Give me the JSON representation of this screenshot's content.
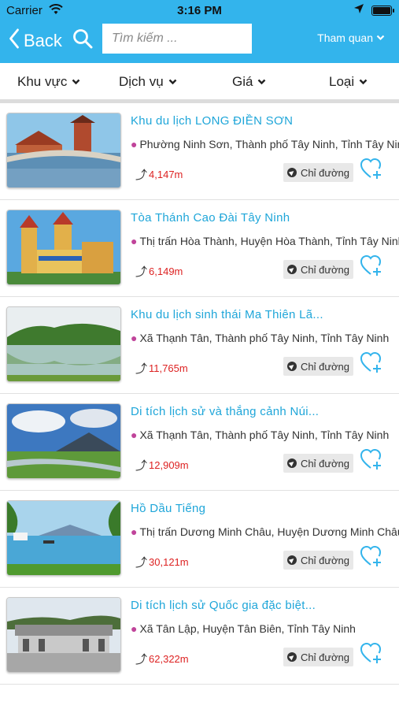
{
  "status": {
    "carrier": "Carrier",
    "time": "3:16 PM"
  },
  "nav": {
    "back_label": "Back",
    "search_placeholder": "Tìm kiếm ...",
    "menu_label": "Tham quan"
  },
  "filters": [
    {
      "label": "Khu vực"
    },
    {
      "label": "Dịch vụ"
    },
    {
      "label": "Giá"
    },
    {
      "label": "Loại"
    }
  ],
  "items": [
    {
      "title": "Khu du lịch LONG ĐIỀN SƠN",
      "address": "Phường Ninh Sơn, Thành phố Tây Ninh, Tỉnh Tây Ninh",
      "distance": "4,147m",
      "direction_label": "Chỉ đường",
      "image": "pagoda-bridge-photo"
    },
    {
      "title": "Tòa Thánh Cao Đài Tây Ninh",
      "address": "Thị trấn Hòa Thành, Huyện Hòa Thành, Tỉnh Tây Ninh",
      "distance": "6,149m",
      "direction_label": "Chỉ đường",
      "image": "cao-dai-temple-photo"
    },
    {
      "title": "Khu du lịch sinh thái Ma Thiên Lã...",
      "address": "Xã Thạnh Tân, Thành phố Tây Ninh, Tỉnh Tây Ninh",
      "distance": "11,765m",
      "direction_label": "Chỉ đường",
      "image": "lake-hill-photo"
    },
    {
      "title": "Di tích lịch sử và thắng cảnh Núi...",
      "address": "Xã Thạnh Tân, Thành phố Tây Ninh, Tỉnh Tây Ninh",
      "distance": "12,909m",
      "direction_label": "Chỉ đường",
      "image": "mountain-field-photo"
    },
    {
      "title": "Hồ Dầu Tiếng",
      "address": "Thị trấn Dương Minh Châu, Huyện Dương Minh Châu",
      "distance": "30,121m",
      "direction_label": "Chỉ đường",
      "image": "lake-boats-photo"
    },
    {
      "title": "Di tích lịch sử Quốc gia đặc biệt...",
      "address": "Xã Tân Lập, Huyện Tân Biên, Tỉnh Tây Ninh",
      "distance": "62,322m",
      "direction_label": "Chỉ đường",
      "image": "memorial-building-photo"
    }
  ]
}
